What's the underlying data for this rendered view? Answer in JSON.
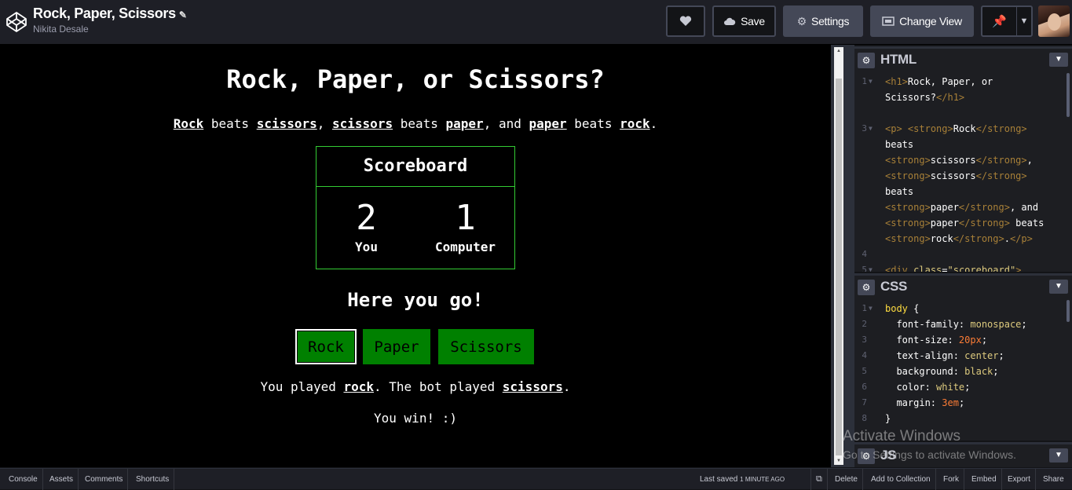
{
  "header": {
    "title": "Rock, Paper, Scissors",
    "author": "Nikita Desale",
    "buttons": {
      "save": "Save",
      "settings": "Settings",
      "change_view": "Change View"
    }
  },
  "preview": {
    "heading": "Rock, Paper, or Scissors?",
    "rules": {
      "s1": "Rock",
      "t1": " beats ",
      "s2": "scissors",
      "t2": ", ",
      "s3": "scissors",
      "t3": " beats ",
      "s4": "paper",
      "t4": ", and ",
      "s5": "paper",
      "t5": " beats ",
      "s6": "rock",
      "t6": "."
    },
    "scoreboard": {
      "title": "Scoreboard",
      "you_score": "2",
      "you_label": "You",
      "computer_score": "1",
      "computer_label": "Computer"
    },
    "prompt": "Here you go!",
    "choices": {
      "rock": "Rock",
      "paper": "Paper",
      "scissors": "Scissors"
    },
    "result": {
      "p1": "You played ",
      "user_choice": "rock",
      "p2": ". The bot played ",
      "bot_choice": "scissors",
      "p3": "."
    },
    "outcome": "You win! :)"
  },
  "editors": {
    "html": {
      "title": "HTML",
      "lines": [
        {
          "n": "1",
          "fold": true
        },
        {
          "n": "",
          "fold": false
        },
        {
          "n": "",
          "fold": false
        },
        {
          "n": "3",
          "fold": true
        },
        {
          "n": "",
          "fold": false
        },
        {
          "n": "",
          "fold": false
        },
        {
          "n": "",
          "fold": false
        },
        {
          "n": "",
          "fold": false
        },
        {
          "n": "",
          "fold": false
        },
        {
          "n": "",
          "fold": false
        },
        {
          "n": "",
          "fold": false
        },
        {
          "n": "4",
          "fold": false
        },
        {
          "n": "5",
          "fold": true
        }
      ]
    },
    "css": {
      "title": "CSS",
      "lines": [
        "1",
        "2",
        "3",
        "4",
        "5",
        "6",
        "7",
        "8"
      ],
      "selector": "body",
      "props": [
        {
          "p": "font-family",
          "v": "monospace"
        },
        {
          "p": "font-size",
          "v": "20px"
        },
        {
          "p": "text-align",
          "v": "center"
        },
        {
          "p": "background",
          "v": "black"
        },
        {
          "p": "color",
          "v": "white"
        },
        {
          "p": "margin",
          "v": "3em"
        }
      ]
    },
    "js": {
      "title": "JS"
    }
  },
  "watermark": {
    "line1": "Activate Windows",
    "line2": "Go to Settings to activate Windows."
  },
  "footer": {
    "items": [
      "Console",
      "Assets",
      "Comments",
      "Shortcuts"
    ],
    "last_saved_label": "Last saved",
    "last_saved_time": "1 MINUTE AGO",
    "actions": [
      "Delete",
      "Add to Collection",
      "Fork",
      "Embed",
      "Export",
      "Share"
    ]
  },
  "colors": {
    "accent_green": "#008000",
    "scoreboard_border": "#33cc33",
    "topbar": "#1e1f26",
    "button_fill": "#444857"
  }
}
